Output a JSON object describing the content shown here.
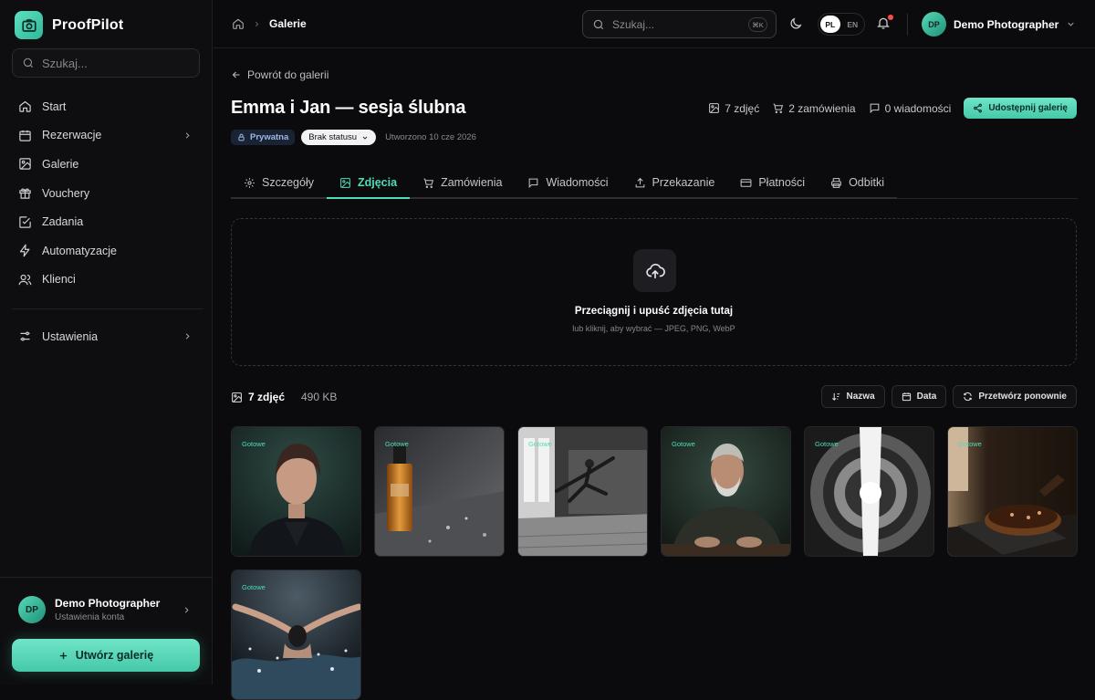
{
  "app": {
    "name": "ProofPilot"
  },
  "sidebar": {
    "search_placeholder": "Szukaj...",
    "items": [
      {
        "label": "Start",
        "icon": "home-icon"
      },
      {
        "label": "Rezerwacje",
        "icon": "calendar-icon",
        "has_submenu": true
      },
      {
        "label": "Galerie",
        "icon": "image-icon"
      },
      {
        "label": "Vouchery",
        "icon": "gift-icon"
      },
      {
        "label": "Zadania",
        "icon": "checkbox-icon"
      },
      {
        "label": "Automatyzacje",
        "icon": "lightning-icon"
      },
      {
        "label": "Klienci",
        "icon": "users-icon"
      }
    ],
    "settings": {
      "label": "Ustawienia",
      "icon": "sliders-icon"
    },
    "user": {
      "initials": "DP",
      "name": "Demo Photographer",
      "subtitle": "Ustawienia konta"
    },
    "create_button": "Utwórz galerię"
  },
  "topbar": {
    "breadcrumb": "Galerie",
    "search_placeholder": "Szukaj...",
    "search_shortcut": "⌘K",
    "languages": [
      "PL",
      "EN"
    ],
    "active_language": "PL",
    "user": {
      "initials": "DP",
      "name": "Demo Photographer"
    }
  },
  "gallery": {
    "back_label": "Powrót do galerii",
    "title": "Emma i Jan — sesja ślubna",
    "stats": {
      "photos": "7 zdjęć",
      "orders": "2 zamówienia",
      "messages": "0 wiadomości"
    },
    "share_button": "Udostępnij galerię",
    "privacy_badge": "Prywatna",
    "status": "Brak statusu",
    "created": "Utworzono 10 cze 2026",
    "tabs": [
      {
        "label": "Szczegóły",
        "icon": "gear-icon"
      },
      {
        "label": "Zdjęcia",
        "icon": "image-icon",
        "active": true
      },
      {
        "label": "Zamówienia",
        "icon": "cart-icon"
      },
      {
        "label": "Wiadomości",
        "icon": "message-icon"
      },
      {
        "label": "Przekazanie",
        "icon": "upload-icon"
      },
      {
        "label": "Płatności",
        "icon": "credit-card-icon"
      },
      {
        "label": "Odbitki",
        "icon": "printer-icon"
      }
    ],
    "dropzone": {
      "title": "Przeciągnij i upuść zdjęcia tutaj",
      "subtitle": "lub kliknij, aby wybrać — JPEG, PNG, WebP"
    },
    "photos_count": "7 zdjęć",
    "photos_size": "490 KB",
    "sort_buttons": {
      "name": "Nazwa",
      "date": "Data",
      "reprocess": "Przetwórz ponownie"
    },
    "photos": [
      {
        "status": "Gotowe",
        "subject": "portrait-woman"
      },
      {
        "status": "Gotowe",
        "subject": "perfume-bottle"
      },
      {
        "status": "Gotowe",
        "subject": "dancer-leap"
      },
      {
        "status": "Gotowe",
        "subject": "old-man-portrait"
      },
      {
        "status": "Gotowe",
        "subject": "spiral-staircase"
      },
      {
        "status": "Gotowe",
        "subject": "chocolate-tart"
      },
      {
        "status": "Gotowe",
        "subject": "swimmer-splash"
      }
    ]
  },
  "colors": {
    "accent": "#4fdcb8",
    "background": "#0b0b0d",
    "sidebar": "#0e0e10",
    "notification": "#ff4a4a"
  }
}
